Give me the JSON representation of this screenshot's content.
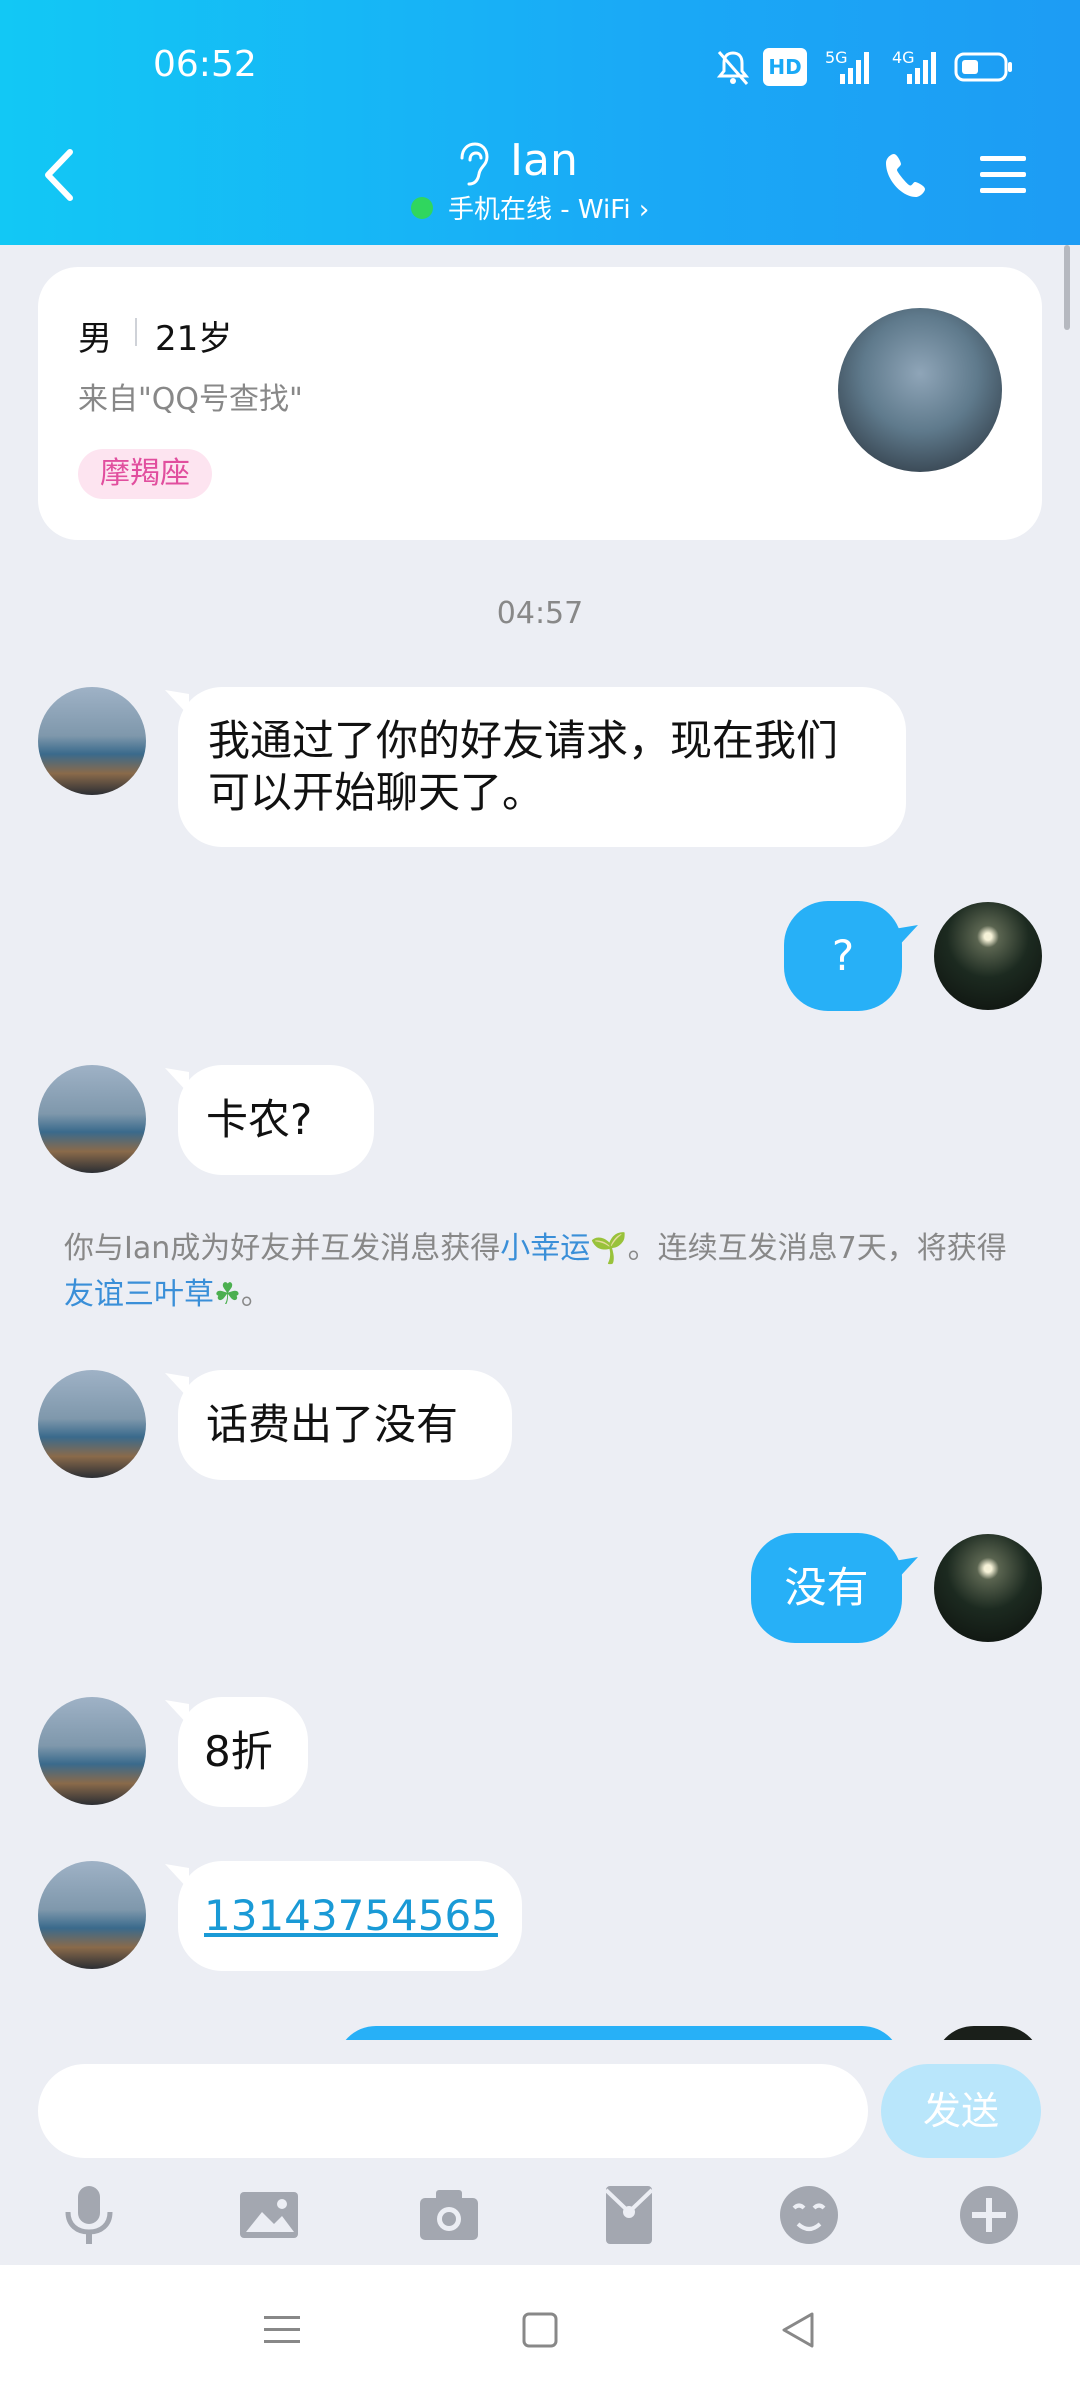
{
  "status_bar": {
    "time": "06:52",
    "hd_label": "HD",
    "net1": "5G",
    "net2": "4G"
  },
  "header": {
    "contact_name": "Ian",
    "online_status": "手机在线 - WiFi"
  },
  "profile_card": {
    "gender": "男",
    "age": "21岁",
    "source": "来自\"QQ号查找\"",
    "zodiac": "摩羯座"
  },
  "timestamp": "04:57",
  "messages": [
    {
      "side": "in",
      "text": "我通过了你的好友请求，现在我们可以开始聊天了。"
    },
    {
      "side": "out",
      "text": "?"
    },
    {
      "side": "in",
      "text": "卡农?"
    },
    {
      "side": "in",
      "text": "话费出了没有"
    },
    {
      "side": "out",
      "text": "没有"
    },
    {
      "side": "in",
      "text": "8折"
    },
    {
      "side": "in",
      "text": "13143754565"
    }
  ],
  "notice": {
    "part1": "你与Ian成为好友并互发消息获得",
    "link1": "小幸运",
    "part2": "。连续互发消息7天，将获得",
    "link2": "友谊三叶草",
    "part3": "。"
  },
  "input": {
    "placeholder": "",
    "send_label": "发送"
  },
  "colors": {
    "header": "#1aa9f6",
    "outgoing_bubble": "#27b0f7",
    "send_disabled": "#b9e6fb",
    "link": "#3a8fd8"
  }
}
